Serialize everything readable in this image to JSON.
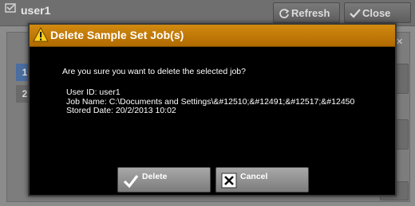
{
  "background": {
    "window_title": "user1",
    "refresh_label": "Refresh",
    "close_label": "Close",
    "rows": [
      "1",
      "2"
    ]
  },
  "dialog": {
    "title": "Delete Sample Set Job(s)",
    "question": "Are you sure you want to delete the selected job?",
    "details": {
      "user_id": "User ID: user1",
      "job_name": "Job Name: C:\\Documents and Settings\\&#12510;&#12491;&#12517;&#12450",
      "stored_date": "Stored Date: 20/2/2013 10:02"
    },
    "buttons": {
      "delete_label": "Delete",
      "cancel_label": "Cancel"
    }
  },
  "colors": {
    "title_bar": "#c27a08",
    "dialog_bg": "#000000",
    "button_bg": "#949494"
  },
  "icons": {
    "title": "warning-icon",
    "delete": "checkmark-icon",
    "cancel": "x-box-icon"
  }
}
